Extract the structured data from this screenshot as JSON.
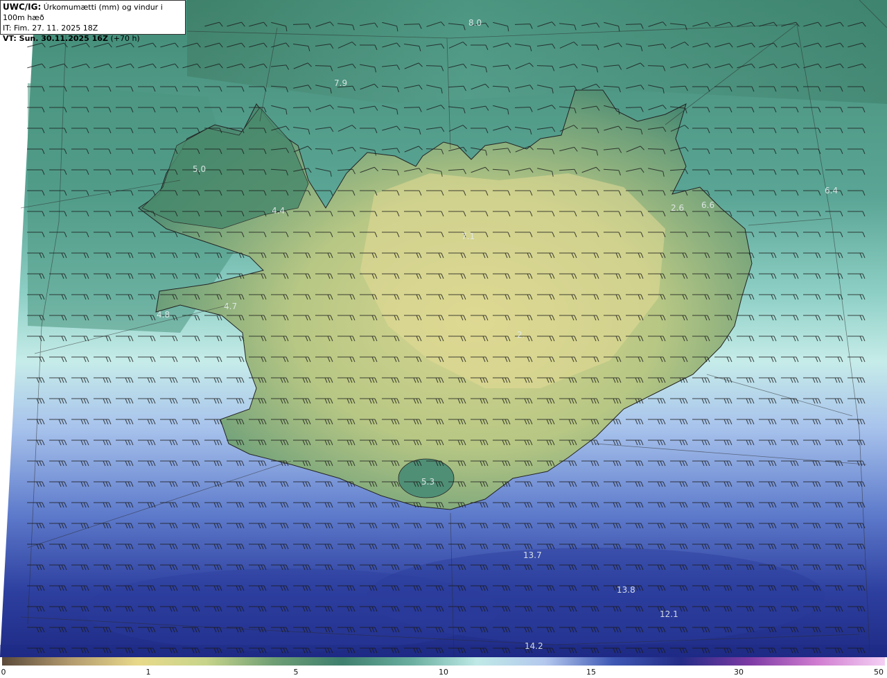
{
  "header": {
    "code": "UWC/IG:",
    "title": "Úrkomumætti (mm) og vindur i 100m hæð",
    "init_time": "IT: Fim. 27. 11. 2025 18Z",
    "valid_prefix": "VT: Sun. 30.11.2025 16Z",
    "valid_suffix": "(+70 h)"
  },
  "value_labels": [
    {
      "text": "8.0"
    },
    {
      "text": "7.9"
    },
    {
      "text": "5.0"
    },
    {
      "text": "4.4"
    },
    {
      "text": "4.7"
    },
    {
      "text": "4.8"
    },
    {
      "text": "7.1"
    },
    {
      "text": "2.6"
    },
    {
      "text": "6.6"
    },
    {
      "text": "6.4"
    },
    {
      "text": "2."
    },
    {
      "text": "5.3"
    },
    {
      "text": "13.7"
    },
    {
      "text": "13.8"
    },
    {
      "text": "12.1"
    },
    {
      "text": "14.2"
    }
  ],
  "colorbar": {
    "ticks": [
      "0",
      "1",
      "5",
      "10",
      "15",
      "30",
      "50"
    ],
    "colors": [
      "#5b4a3a",
      "#b39a6e",
      "#e8d98a",
      "#c7d48a",
      "#6e9e74",
      "#3f7f6e",
      "#68ad9e",
      "#bfe9e6",
      "#b4c8ee",
      "#3e58b4",
      "#242c86",
      "#7c3aa4",
      "#d07cd0",
      "#f4d0f4"
    ]
  }
}
